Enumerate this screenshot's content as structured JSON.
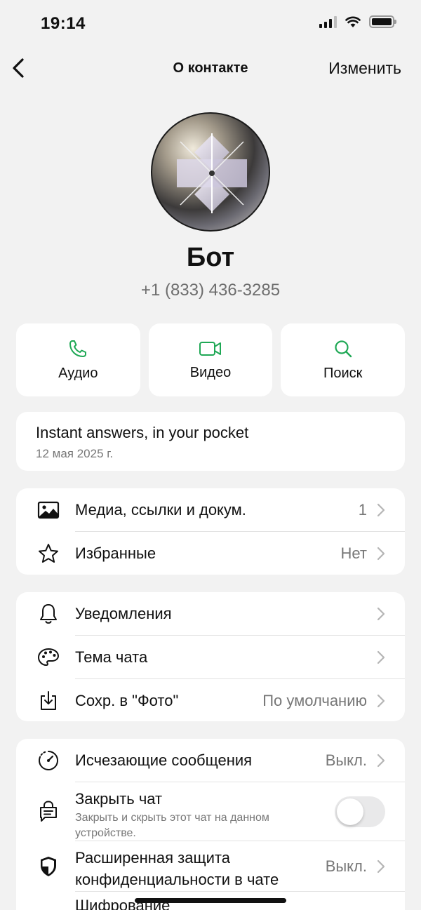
{
  "status_bar": {
    "time": "19:14"
  },
  "nav": {
    "title": "О контакте",
    "edit_label": "Изменить"
  },
  "profile": {
    "name": "Бот",
    "phone": "+1 (833) 436-3285"
  },
  "actions": [
    {
      "label": "Аудио",
      "icon": "phone-icon"
    },
    {
      "label": "Видео",
      "icon": "video-icon"
    },
    {
      "label": "Поиск",
      "icon": "search-icon"
    }
  ],
  "about": {
    "text": "Instant answers, in your pocket",
    "date": "12 мая 2025 г."
  },
  "media_section": {
    "media": {
      "label": "Медиа, ссылки и докум.",
      "value": "1"
    },
    "starred": {
      "label": "Избранные",
      "value": "Нет"
    }
  },
  "settings_section": {
    "notifications": {
      "label": "Уведомления"
    },
    "theme": {
      "label": "Тема чата"
    },
    "save_photo": {
      "label": "Сохр. в \"Фото\"",
      "value": "По умолчанию"
    }
  },
  "privacy_section": {
    "disappearing": {
      "label": "Исчезающие сообщения",
      "value": "Выкл."
    },
    "lock_chat": {
      "label": "Закрыть чат",
      "sublabel_line1": "Закрыть и скрыть этот чат на данном",
      "sublabel_line2": "устройстве.",
      "enabled": false
    },
    "advanced_privacy": {
      "label_line1": "Расширенная защита",
      "label_line2": "конфиденциальности в чате",
      "value": "Выкл."
    },
    "encryption": {
      "label": "Шифрование"
    }
  },
  "colors": {
    "accent": "#1fa855",
    "background": "#f2f2f2",
    "card": "#ffffff",
    "secondary_text": "#777777"
  }
}
